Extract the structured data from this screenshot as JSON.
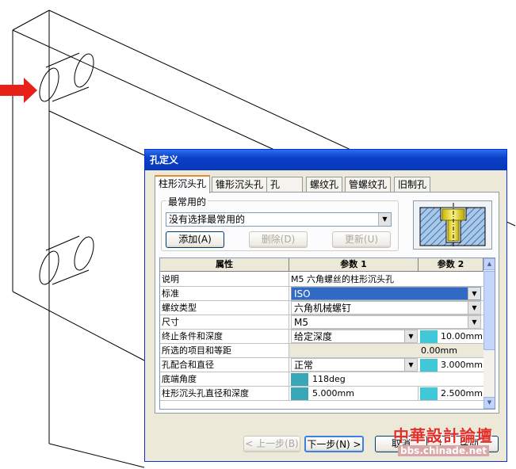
{
  "dialog": {
    "title": "孔定义",
    "tabs": [
      {
        "label": "柱形沉头孔",
        "active": true
      },
      {
        "label": "锥形沉头孔",
        "active": false
      },
      {
        "label": "孔",
        "active": false
      },
      {
        "label": "螺纹孔",
        "active": false
      },
      {
        "label": "管螺纹孔",
        "active": false
      },
      {
        "label": "旧制孔",
        "active": false
      }
    ],
    "common": {
      "group_label": "最常用的",
      "selected": "没有选择最常用的",
      "add_label": "添加(A)",
      "delete_label": "删除(D)",
      "update_label": "更新(U)"
    },
    "grid": {
      "headers": [
        "属性",
        "参数 1",
        "参数 2"
      ],
      "rows": [
        {
          "prop": "说明",
          "p1": "M5 六角螺丝的柱形沉头孔",
          "p2": ""
        },
        {
          "prop": "标准",
          "p1": "ISO",
          "p2": ""
        },
        {
          "prop": "螺纹类型",
          "p1": "六角机械螺钉",
          "p2": ""
        },
        {
          "prop": "尺寸",
          "p1": "M5",
          "p2": ""
        },
        {
          "prop": "终止条件和深度",
          "p1": "给定深度",
          "p2": "10.00mm"
        },
        {
          "prop": "所选的项目和等距",
          "p1": "",
          "p2": "0.00mm"
        },
        {
          "prop": "孔配合和直径",
          "p1": "正常",
          "p2": "3.000mm"
        },
        {
          "prop": "底端角度",
          "p1": "118deg",
          "p2": ""
        },
        {
          "prop": "柱形沉头孔直径和深度",
          "p1": "5.000mm",
          "p2": "2.500mm"
        }
      ]
    },
    "buttons": {
      "prev": "< 上一步(B)",
      "next": "下一步(N) >",
      "cancel": "取消",
      "help": "帮助"
    }
  },
  "watermark": {
    "title": "中華設計論壇",
    "url": "bbs.chinade.net"
  },
  "colors": {
    "titlebar": "#0a3fc7",
    "active_tab_accent": "#e68b2c",
    "selection": "#316ac5",
    "arrow": "#e8201a"
  }
}
